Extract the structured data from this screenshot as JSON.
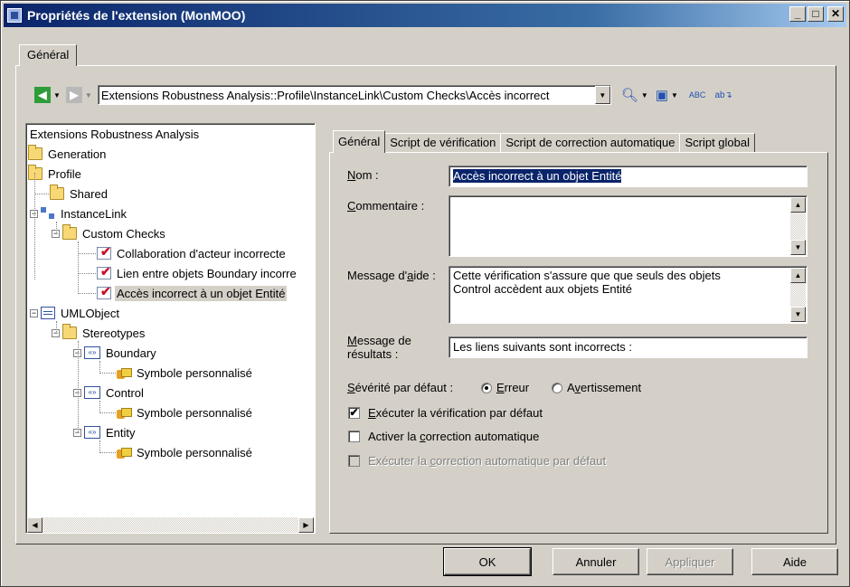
{
  "window": {
    "title": "Propriétés de l'extension (MonMOO)"
  },
  "outer_tab": {
    "label": "Général"
  },
  "toolbar": {
    "path": "Extensions Robustness Analysis::Profile\\InstanceLink\\Custom Checks\\Accès incorrect"
  },
  "tree": {
    "root": "Extensions Robustness Analysis",
    "nodes": [
      {
        "label": "Generation",
        "icon": "folder-icon"
      },
      {
        "label": "Profile",
        "icon": "folder-icon"
      },
      {
        "label": "Shared",
        "icon": "folder-icon"
      },
      {
        "label": "InstanceLink",
        "icon": "instancelink-icon",
        "expander": "−"
      },
      {
        "label": "Custom Checks",
        "icon": "folder-icon",
        "expander": "−"
      },
      {
        "label": "Collaboration d'acteur incorrecte",
        "icon": "custom-check-icon"
      },
      {
        "label": "Lien entre objets Boundary incorre",
        "icon": "custom-check-icon"
      },
      {
        "label": "Accès incorrect à un objet Entité",
        "icon": "custom-check-icon",
        "selected": true
      },
      {
        "label": "UMLObject",
        "icon": "umlobject-icon",
        "expander": "−"
      },
      {
        "label": "Stereotypes",
        "icon": "folder-icon",
        "expander": "−"
      },
      {
        "label": "Boundary",
        "icon": "stereotype-icon",
        "expander": "−",
        "icon_text": "«»"
      },
      {
        "label": "Symbole personnalisé",
        "icon": "custom-symbol-icon"
      },
      {
        "label": "Control",
        "icon": "stereotype-icon",
        "expander": "−",
        "icon_text": "«»"
      },
      {
        "label": "Symbole personnalisé",
        "icon": "custom-symbol-icon"
      },
      {
        "label": "Entity",
        "icon": "stereotype-icon",
        "expander": "−",
        "icon_text": "«»"
      },
      {
        "label": "Symbole personnalisé",
        "icon": "custom-symbol-icon"
      }
    ]
  },
  "inner_tabs": [
    "Général",
    "Script de vérification",
    "Script de correction automatique",
    "Script global"
  ],
  "form": {
    "name_label_u": "N",
    "name_label_rest": "om :",
    "name_value": "Accès incorrect à un objet Entité",
    "comment_label_u": "C",
    "comment_label_rest": "ommentaire :",
    "comment_value": "",
    "help_label_pre": "Message d'",
    "help_label_u": "a",
    "help_label_post": "ide :",
    "help_value_line1": "Cette vérification s'assure que que seuls des objets",
    "help_value_line2": "Control accèdent aux objets Entité",
    "result_label_u": "M",
    "result_label_line1_rest": "essage de",
    "result_label_line2": "résultats :",
    "result_value": "Les liens suivants sont incorrects :",
    "severity_label_u": "S",
    "severity_label_rest": "évérité par défaut :",
    "severity_error_u": "E",
    "severity_error_rest": "rreur",
    "severity_warning_pre": "A",
    "severity_warning_u": "v",
    "severity_warning_rest": "ertissement",
    "cb1_u": "E",
    "cb1_rest": "xécuter la vérification par défaut",
    "cb1_checked": true,
    "cb2_pre": "Activer la ",
    "cb2_u": "c",
    "cb2_rest": "orrection automatique",
    "cb2_checked": false,
    "cb3_pre": "Exécuter la ",
    "cb3_u": "c",
    "cb3_rest": "orrection automatique par défaut",
    "cb3_enabled": false
  },
  "buttons": {
    "ok": "OK",
    "cancel": "Annuler",
    "apply": "Appliquer",
    "help": "Aide"
  },
  "colors": {
    "titlebar_start": "#0a246a",
    "titlebar_end": "#a6caf0",
    "selection": "#0a246a",
    "face": "#d4d0c8"
  }
}
